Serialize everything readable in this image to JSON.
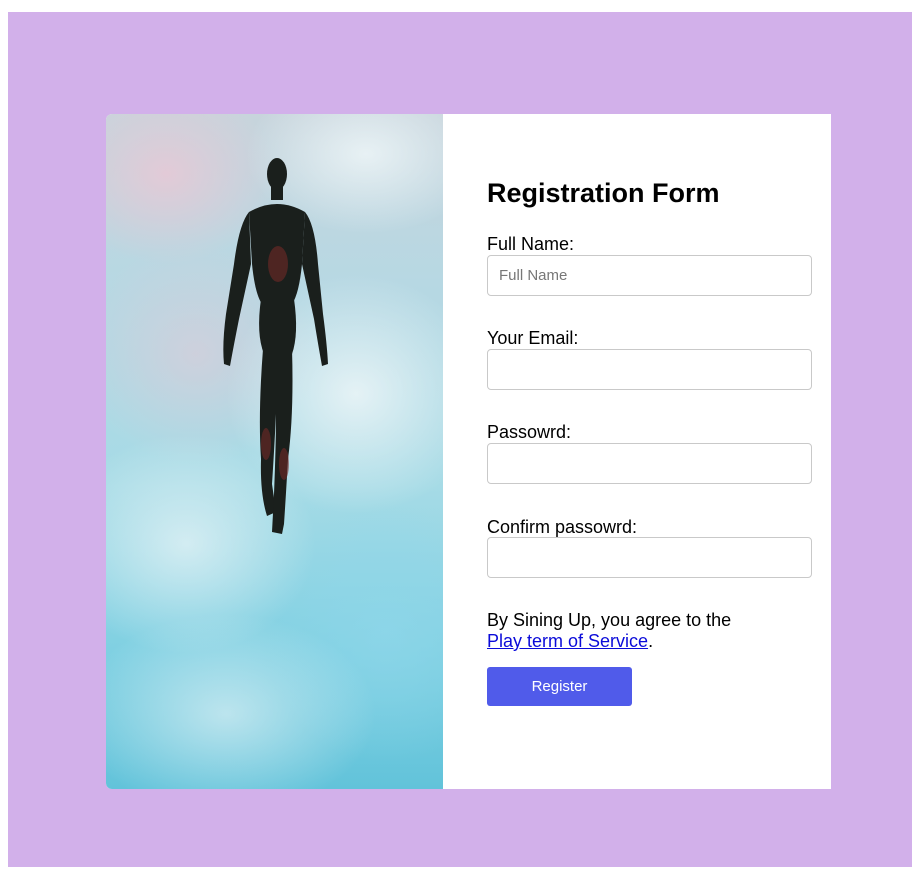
{
  "colors": {
    "page_background": "#d2b0ea",
    "card_background": "#ffffff",
    "button_background": "#505bea",
    "link_color": "#0b0bd9"
  },
  "hero": {
    "icon": "flying-figure-illustration"
  },
  "form": {
    "title": "Registration Form",
    "fields": [
      {
        "label": "Full Name:",
        "placeholder": "Full Name",
        "value": ""
      },
      {
        "label": "Your Email:",
        "placeholder": "",
        "value": ""
      },
      {
        "label": "Passowrd:",
        "placeholder": "",
        "value": ""
      },
      {
        "label": "Confirm passowrd:",
        "placeholder": "",
        "value": ""
      }
    ],
    "agreement_text": "By Sining Up, you agree to the",
    "terms_link": "Play term of Service",
    "agreement_end": ".",
    "register_label": "Register"
  }
}
